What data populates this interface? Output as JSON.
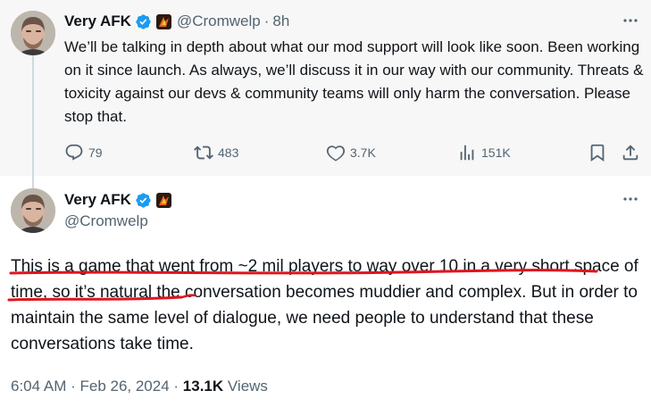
{
  "reply_tweet": {
    "display_name": "Very AFK",
    "handle": "@Cromwelp",
    "separator": "·",
    "time_ago": "8h",
    "text": "We’ll be talking in depth about what our mod support will look like soon. Been working on it since launch. As always, we’ll discuss it in our way with our community. Threats & toxicity against our devs & community teams will only harm the conversation. Please stop that.",
    "more_label": "···",
    "actions": {
      "replies": "79",
      "reposts": "483",
      "likes": "3.7K",
      "views": "151K"
    }
  },
  "main_tweet": {
    "display_name": "Very AFK",
    "handle": "@Cromwelp",
    "more_label": "···",
    "text_highlighted": "This is a game that went from ~2 mil players to way over 10 in a very short space of time",
    "text_rest": ", so it’s natural the conversation becomes muddier and complex. But in order to maintain the same level of dialogue, we need people to understand that these conversations take time.",
    "timestamp": "6:04 AM · Feb 26, 2024 · ",
    "views_count": "13.1K",
    "views_label": " Views"
  },
  "colors": {
    "text": "#0f1419",
    "muted": "#536471",
    "verified": "#1d9bf0",
    "underline": "#e0141e",
    "reply_bg": "#f7f7f7",
    "thread_line": "#cfd9de"
  },
  "icons": {
    "verified": "verified-check-icon",
    "badge": "affiliate-badge-icon",
    "reply": "speech-bubble-icon",
    "repost": "repost-arrows-icon",
    "like": "heart-icon",
    "views": "bar-chart-icon",
    "bookmark": "bookmark-icon",
    "share": "share-upload-icon"
  }
}
